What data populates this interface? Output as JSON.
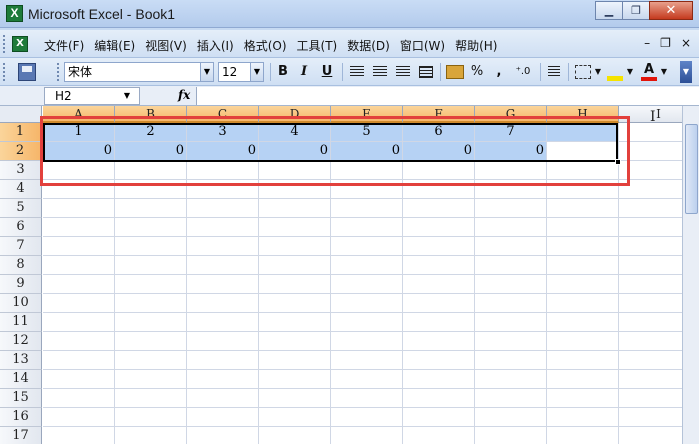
{
  "window": {
    "title": "Microsoft Excel - Book1",
    "app_icon": "X",
    "buttons": {
      "minimize": "▁",
      "restore": "❐",
      "close": "✕"
    }
  },
  "menubar": {
    "items": [
      "文件(F)",
      "编辑(E)",
      "视图(V)",
      "插入(I)",
      "格式(O)",
      "工具(T)",
      "数据(D)",
      "窗口(W)",
      "帮助(H)"
    ],
    "right": {
      "minimize": "–",
      "restore": "❐",
      "close": "×"
    }
  },
  "toolbar": {
    "font": "宋体",
    "size": "12",
    "bold": "B",
    "italic": "I",
    "underline": "U",
    "percent": "%",
    "comma": ",",
    "decimal": "⁺.0",
    "font_color": "A"
  },
  "formulabar": {
    "namebox": "H2",
    "fx": "fx",
    "value": ""
  },
  "sheet": {
    "columns": [
      "A",
      "B",
      "C",
      "D",
      "E",
      "F",
      "G",
      "H",
      "I"
    ],
    "selected_columns": [
      "A",
      "B",
      "C",
      "D",
      "E",
      "F",
      "G",
      "H"
    ],
    "rows": [
      "1",
      "2",
      "3",
      "4",
      "5",
      "6",
      "7",
      "8",
      "9",
      "10",
      "11",
      "12",
      "13",
      "14",
      "15",
      "16",
      "17"
    ],
    "selected_rows": [
      "1",
      "2"
    ],
    "row1": [
      "1",
      "2",
      "3",
      "4",
      "5",
      "6",
      "7",
      ""
    ],
    "row2": [
      "0",
      "0",
      "0",
      "0",
      "0",
      "0",
      "0",
      ""
    ],
    "active_cell": "H2",
    "cursor_glyph": "I"
  },
  "colors": {
    "selection": "#b6d2f4",
    "header_selected": "#f6b66a",
    "annotation": "#e2403c"
  }
}
